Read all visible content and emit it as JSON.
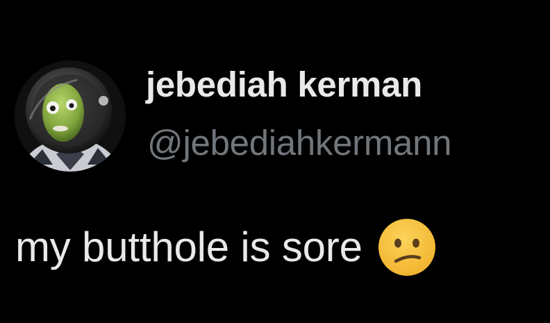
{
  "author": {
    "display_name": "jebediah kerman",
    "handle": "@jebediahkermann",
    "avatar_icon": "kerbal-astronaut-avatar"
  },
  "tweet": {
    "text": "my butthole is sore",
    "emoji_icon": "confused-face-emoji"
  },
  "colors": {
    "background": "#000000",
    "primary_text": "#e7e9ea",
    "secondary_text": "#71767b",
    "emoji_face": "#f7c13f"
  }
}
